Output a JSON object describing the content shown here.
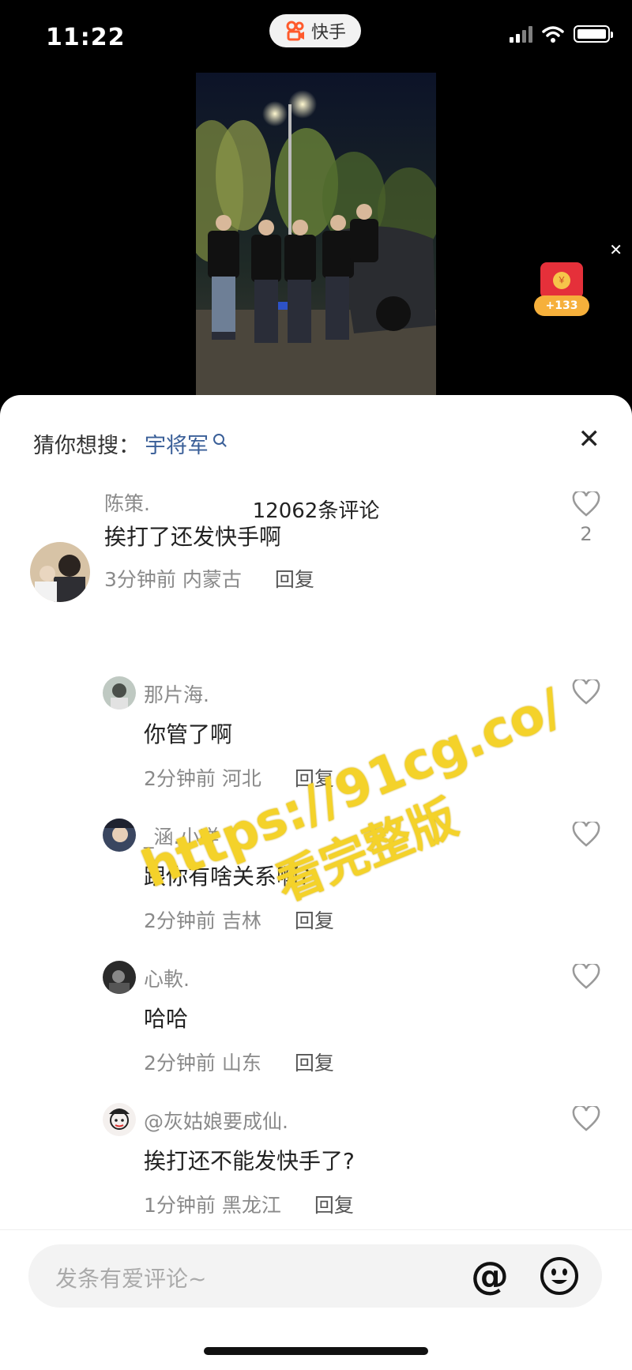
{
  "status_bar": {
    "time": "11:22",
    "app_name": "快手"
  },
  "suggest": {
    "label": "猜你想搜：",
    "term": "宇将军"
  },
  "comment_count": "12062条评论",
  "red_packet_badge": "+133",
  "comments": [
    {
      "name": "陈策.",
      "text": "挨打了还发快手啊",
      "time": "3分钟前",
      "location": "内蒙古",
      "reply": "回复",
      "likes": "2"
    },
    {
      "name": "那片海.",
      "text": "你管了啊",
      "time": "2分钟前",
      "location": "河北",
      "reply": "回复"
    },
    {
      "name": "_涵.小咩",
      "text": "跟你有啥关系啊?",
      "time": "2分钟前",
      "location": "吉林",
      "reply": "回复"
    },
    {
      "name": "心軟.",
      "text": "哈哈",
      "time": "2分钟前",
      "location": "山东",
      "reply": "回复"
    },
    {
      "name": "@灰姑娘要成仙.",
      "text": "挨打还不能发快手了?",
      "time": "1分钟前",
      "location": "黑龙江",
      "reply": "回复"
    }
  ],
  "watermark": {
    "line1": "https://91cg.co/",
    "line2": "看完整版"
  },
  "composer": {
    "placeholder": "发条有爱评论~"
  }
}
